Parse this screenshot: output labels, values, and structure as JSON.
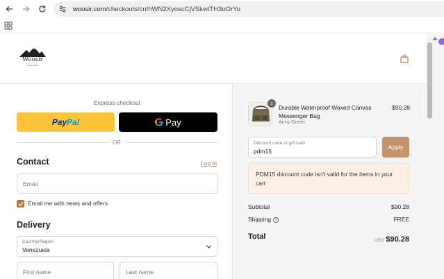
{
  "browser": {
    "url_host": "woosir.com",
    "url_path": "/checkouts/cn/hWN2XyoscCjVSkwtTH3oOrYo",
    "icons": [
      "back-icon",
      "forward-icon",
      "reload-icon",
      "site-info-icon",
      "apps-icon"
    ]
  },
  "header": {
    "logo_text": "Woosir",
    "logo_subtext": "sports gear",
    "cart_icon": "shopping-bag-icon"
  },
  "checkout": {
    "express_title": "Express checkout",
    "paypal_a": "Pay",
    "paypal_b": "Pal",
    "gpay_label": "Pay",
    "or_text": "OR",
    "contact": {
      "heading": "Contact",
      "login_link": "Log in",
      "email_placeholder": "Email",
      "news_label": "Email me with news and offers",
      "news_checked": true
    },
    "delivery": {
      "heading": "Delivery",
      "country_label": "Country/Region",
      "country_value": "Venezuela",
      "first_name_placeholder": "First name",
      "last_name_placeholder": "Last name"
    }
  },
  "summary": {
    "item": {
      "quantity": "1",
      "name": "Durable Waterproof Waxed Canvas Messenger Bag",
      "variant": "Army Green",
      "price": "$90.28"
    },
    "discount": {
      "label": "Discount code or gift card",
      "value": "pdm15",
      "apply_label": "Apply"
    },
    "error_message": "PDM15 discount code isn't valid for the items in your cart",
    "subtotal_label": "Subtotal",
    "subtotal_value": "$90.28",
    "shipping_label": "Shipping",
    "shipping_value": "FREE",
    "total_label": "Total",
    "total_currency": "USD",
    "total_value": "$90.28"
  },
  "colors": {
    "accent": "#b27a52",
    "apply_button": "#c3956f",
    "paypal_yellow": "#ffc439",
    "error_bg": "#fdf1e7"
  }
}
